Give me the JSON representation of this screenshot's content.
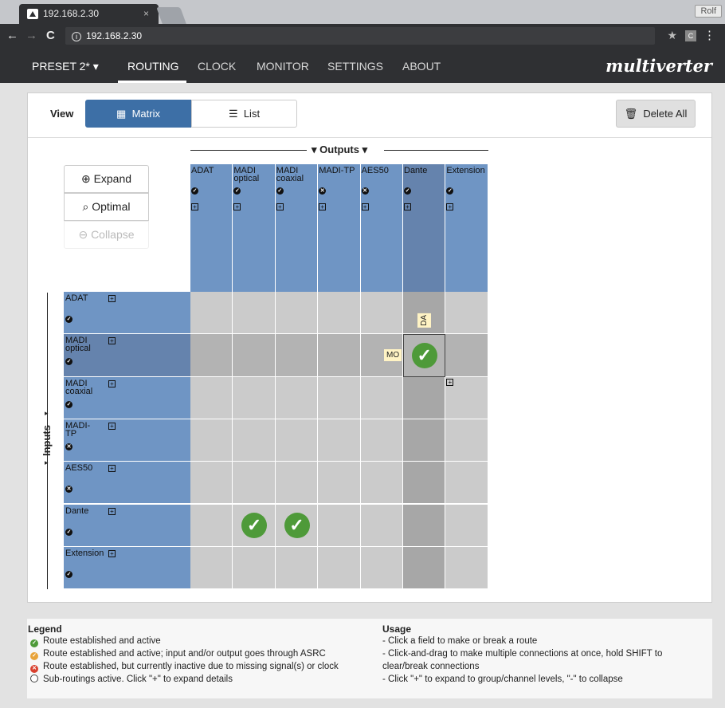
{
  "browser": {
    "tab_title": "192.168.2.30",
    "tab_close": "×",
    "url": "192.168.2.30",
    "profile": "Rolf"
  },
  "nav": {
    "preset": "PRESET 2* ▾",
    "items": [
      "ROUTING",
      "CLOCK",
      "MONITOR",
      "SETTINGS",
      "ABOUT"
    ],
    "active": "ROUTING",
    "logo": "multiverter"
  },
  "toolbar": {
    "view_label": "View",
    "matrix_label": "Matrix",
    "list_label": "List",
    "delete_label": "Delete All"
  },
  "side_buttons": {
    "expand": "Expand",
    "optimal": "Optimal",
    "collapse": "Collapse"
  },
  "matrix": {
    "outputs_title": "▾ Outputs ▾",
    "inputs_title": "Inputs",
    "outputs": [
      {
        "name": "ADAT",
        "status": "ok"
      },
      {
        "name": "MADI optical",
        "status": "ok"
      },
      {
        "name": "MADI coaxial",
        "status": "ok"
      },
      {
        "name": "MADI-TP",
        "status": "inactive"
      },
      {
        "name": "AES50",
        "status": "inactive"
      },
      {
        "name": "Dante",
        "status": "ok"
      },
      {
        "name": "Extension",
        "status": "ok"
      }
    ],
    "inputs": [
      {
        "name": "ADAT",
        "status": "ok"
      },
      {
        "name": "MADI optical",
        "status": "ok"
      },
      {
        "name": "MADI coaxial",
        "status": "ok"
      },
      {
        "name": "MADI-TP",
        "status": "inactive"
      },
      {
        "name": "AES50",
        "status": "inactive"
      },
      {
        "name": "Dante",
        "status": "ok"
      },
      {
        "name": "Extension",
        "status": "ok"
      }
    ],
    "routes": [
      {
        "input": 1,
        "output": 5
      },
      {
        "input": 5,
        "output": 1
      },
      {
        "input": 5,
        "output": 2
      }
    ],
    "selected": {
      "input": 1,
      "output": 5
    },
    "hover_tags": {
      "row": "MO",
      "col": "DA"
    }
  },
  "legend": {
    "title": "Legend",
    "items": [
      {
        "text": "Route established and active",
        "color": "#4e9a39",
        "symbol": "✓"
      },
      {
        "text": "Route established and active; input and/or output goes through ASRC",
        "color": "#e8a33a",
        "symbol": "✓"
      },
      {
        "text": "Route established, but currently inactive due to missing signal(s) or clock",
        "color": "#d9412f",
        "symbol": "✕"
      },
      {
        "text": "Sub-routings active. Click \"+\" to expand details",
        "color": "#ffffff",
        "symbol": ""
      }
    ]
  },
  "usage": {
    "title": "Usage",
    "lines": [
      "- Click a field to make or break a route",
      "- Click-and-drag to make multiple connections at once, hold SHIFT to",
      "clear/break connections",
      "- Click \"+\" to expand to group/channel levels, \"-\" to collapse"
    ]
  }
}
